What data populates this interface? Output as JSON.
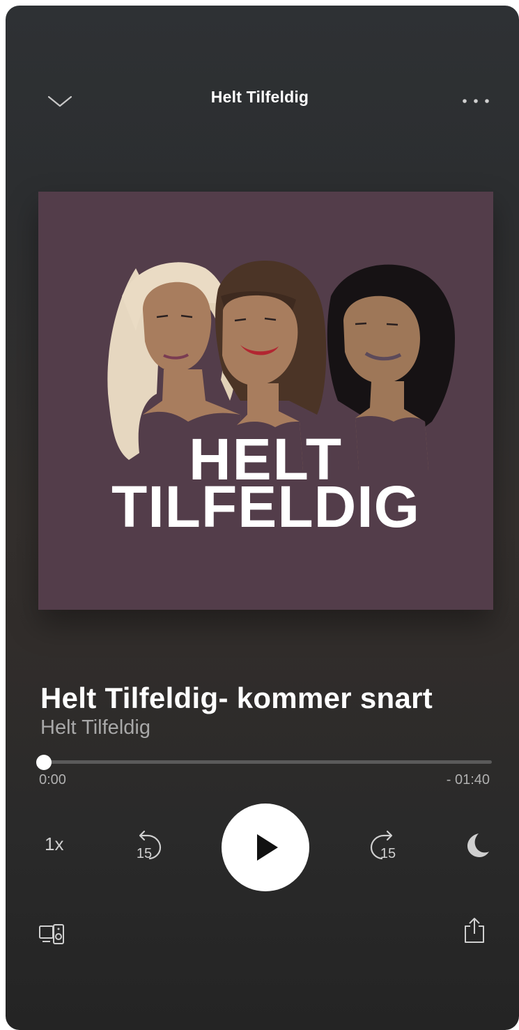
{
  "header": {
    "title": "Helt Tilfeldig",
    "collapse_icon": "chevron-down-icon",
    "more_icon": "more-horizontal-icon"
  },
  "artwork": {
    "line1": "HELT",
    "line2": "TILFELDIG",
    "background": "#533d4a"
  },
  "episode": {
    "title": "Helt Tilfeldig- kommer snart",
    "show": "Helt Tilfeldig"
  },
  "progress": {
    "elapsed": "0:00",
    "remaining": "- 01:40",
    "fraction": 0.0
  },
  "controls": {
    "speed": "1x",
    "skip_back_seconds": "15",
    "skip_forward_seconds": "15",
    "play_icon": "play-icon",
    "sleep_icon": "moon-icon"
  },
  "footer": {
    "devices_icon": "devices-icon",
    "share_icon": "share-icon"
  }
}
